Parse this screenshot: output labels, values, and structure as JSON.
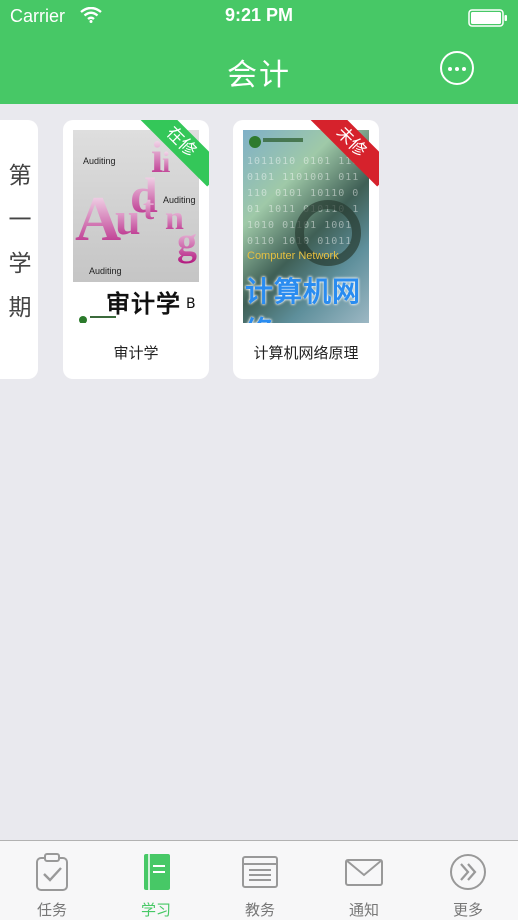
{
  "status_bar": {
    "carrier": "Carrier",
    "time": "9:21 PM"
  },
  "nav": {
    "title": "会计",
    "more_icon": "more-icon"
  },
  "semester": {
    "label": "第一学期"
  },
  "courses": [
    {
      "name": "审计学",
      "status": "在修",
      "status_color": "#34c759",
      "cover": {
        "word": "Auditing",
        "title": "审计学",
        "edition": "B"
      }
    },
    {
      "name": "计算机网络原理",
      "status": "未修",
      "status_color": "#d6222c",
      "cover": {
        "subtitle": "Computer Network",
        "title": "计算机网络"
      }
    }
  ],
  "tabs": [
    {
      "label": "任务",
      "icon": "clipboard-icon",
      "active": false
    },
    {
      "label": "学习",
      "icon": "book-icon",
      "active": true
    },
    {
      "label": "教务",
      "icon": "window-icon",
      "active": false
    },
    {
      "label": "通知",
      "icon": "envelope-icon",
      "active": false
    },
    {
      "label": "更多",
      "icon": "double-chevron-icon",
      "active": false
    }
  ],
  "colors": {
    "accent": "#47c866",
    "background": "#e9e9ee",
    "tab_inactive": "#777777"
  }
}
